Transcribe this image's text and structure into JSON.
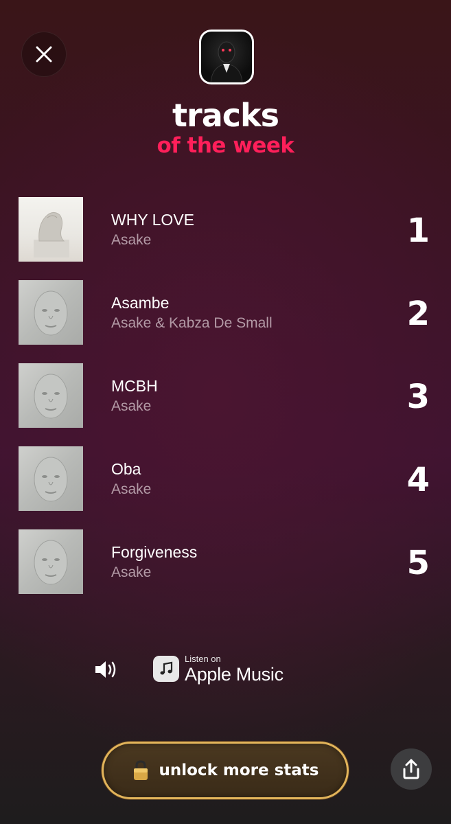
{
  "header": {
    "close_icon": "close-icon",
    "title": "tracks",
    "subtitle": "of the week",
    "accent_color": "#ff1f5a"
  },
  "tracks": [
    {
      "rank": "1",
      "title": "WHY LOVE",
      "artist": "Asake"
    },
    {
      "rank": "2",
      "title": "Asambe",
      "artist": "Asake & Kabza De Small"
    },
    {
      "rank": "3",
      "title": "MCBH",
      "artist": "Asake"
    },
    {
      "rank": "4",
      "title": "Oba",
      "artist": "Asake"
    },
    {
      "rank": "5",
      "title": "Forgiveness",
      "artist": "Asake"
    }
  ],
  "player": {
    "speaker_icon": "speaker-icon",
    "apple_music_small": "Listen on",
    "apple_music_big": "Apple Music"
  },
  "footer": {
    "unlock_label": "unlock more stats",
    "unlock_icon": "lock-icon",
    "share_icon": "share-icon",
    "gold_color": "#e2b45a"
  }
}
